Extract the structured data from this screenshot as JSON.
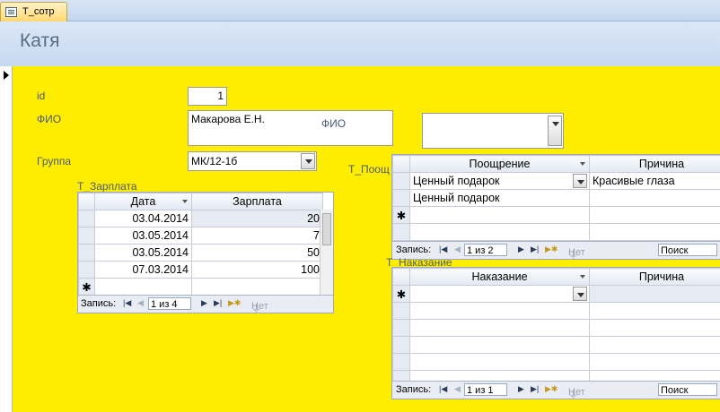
{
  "tab": {
    "label": "Т_сотр"
  },
  "header": {
    "title": "Катя"
  },
  "fields": {
    "id_label": "id",
    "id_value": "1",
    "fio_label": "ФИО",
    "fio_value": "Макарова Е.Н.",
    "fio_inner_label": "ФИО",
    "group_label": "Группа",
    "group_value": "МК/12-1б"
  },
  "salary": {
    "label": "Т_Зарплата",
    "columns": [
      "Дата",
      "Зарплата"
    ],
    "rows": [
      {
        "date": "03.04.2014",
        "amount": "20"
      },
      {
        "date": "03.05.2014",
        "amount": "7"
      },
      {
        "date": "03.05.2014",
        "amount": "50"
      },
      {
        "date": "07.03.2014",
        "amount": "100"
      }
    ],
    "nav": {
      "record_label": "Запись:",
      "position": "1 из 4",
      "filter": "Нет фильт"
    }
  },
  "bonus": {
    "label": "Т_Поощ",
    "columns": [
      "Поощрение",
      "Причина"
    ],
    "rows": [
      {
        "type": "Ценный подарок",
        "reason": "Красивые глаза"
      },
      {
        "type": "Ценный подарок",
        "reason": ""
      }
    ],
    "nav": {
      "record_label": "Запись:",
      "position": "1 из 2",
      "filter": "Нет фильтра",
      "search": "Поиск"
    }
  },
  "penalty": {
    "label": "Т_Наказание",
    "columns": [
      "Наказание",
      "Причина"
    ],
    "nav": {
      "record_label": "Запись:",
      "position": "1 из 1",
      "filter": "Нет фильтра",
      "search": "Поиск"
    }
  },
  "colors": {
    "form_bg": "#ffed00",
    "header_bg": "#c6d9f1",
    "title": "#5b6b80"
  }
}
